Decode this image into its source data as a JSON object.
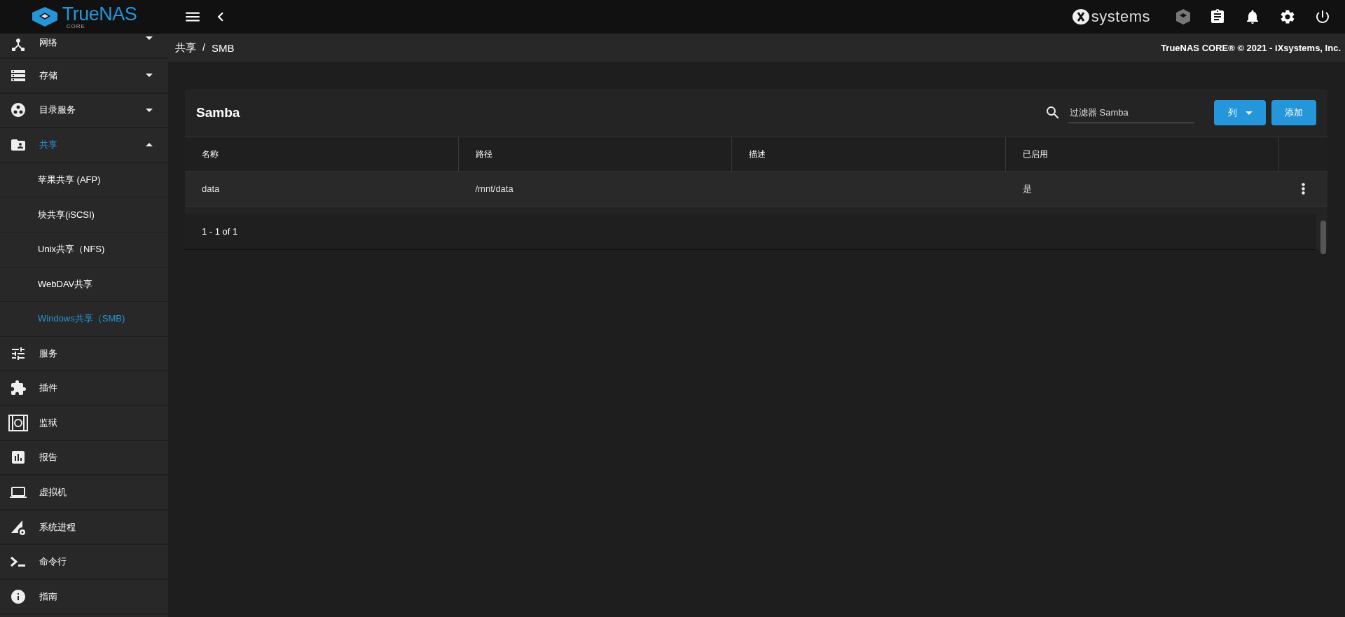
{
  "topbar": {
    "brand": "TrueNAS",
    "brand_sub": "CORE",
    "vendor": "systems"
  },
  "sidebar": {
    "items": [
      {
        "label": "网络",
        "expanded": false,
        "selected": false
      },
      {
        "label": "存储",
        "expanded": false,
        "selected": false
      },
      {
        "label": "目录服务",
        "expanded": false,
        "selected": false
      },
      {
        "label": "共享",
        "expanded": true,
        "selected": true,
        "children": [
          {
            "label": "苹果共享 (AFP)",
            "selected": false
          },
          {
            "label": "块共享(iSCSI)",
            "selected": false
          },
          {
            "label": "Unix共享（NFS)",
            "selected": false
          },
          {
            "label": "WebDAV共享",
            "selected": false
          },
          {
            "label": "Windows共享（SMB)",
            "selected": true
          }
        ]
      },
      {
        "label": "服务",
        "selected": false
      },
      {
        "label": "插件",
        "selected": false
      },
      {
        "label": "监狱",
        "selected": false
      },
      {
        "label": "报告",
        "selected": false
      },
      {
        "label": "虚拟机",
        "selected": false
      },
      {
        "label": "系统进程",
        "selected": false
      },
      {
        "label": "命令行",
        "selected": false
      },
      {
        "label": "指南",
        "selected": false
      }
    ]
  },
  "breadcrumb": {
    "items": [
      "共享",
      "SMB"
    ],
    "separator": "/",
    "copyright": "TrueNAS CORE® © 2021 - iXsystems, Inc."
  },
  "card": {
    "title": "Samba",
    "search": {
      "placeholder": "过滤器 Samba"
    },
    "buttons": [
      {
        "kind": "dropdown",
        "label": "列"
      },
      {
        "kind": "plain",
        "label": "添加"
      }
    ],
    "columns": [
      "名称",
      "路径",
      "描述",
      "已启用"
    ],
    "rows": [
      {
        "name": "data",
        "path": "/mnt/data",
        "enabled": "是"
      }
    ],
    "pagination": "1 - 1 of 1"
  }
}
